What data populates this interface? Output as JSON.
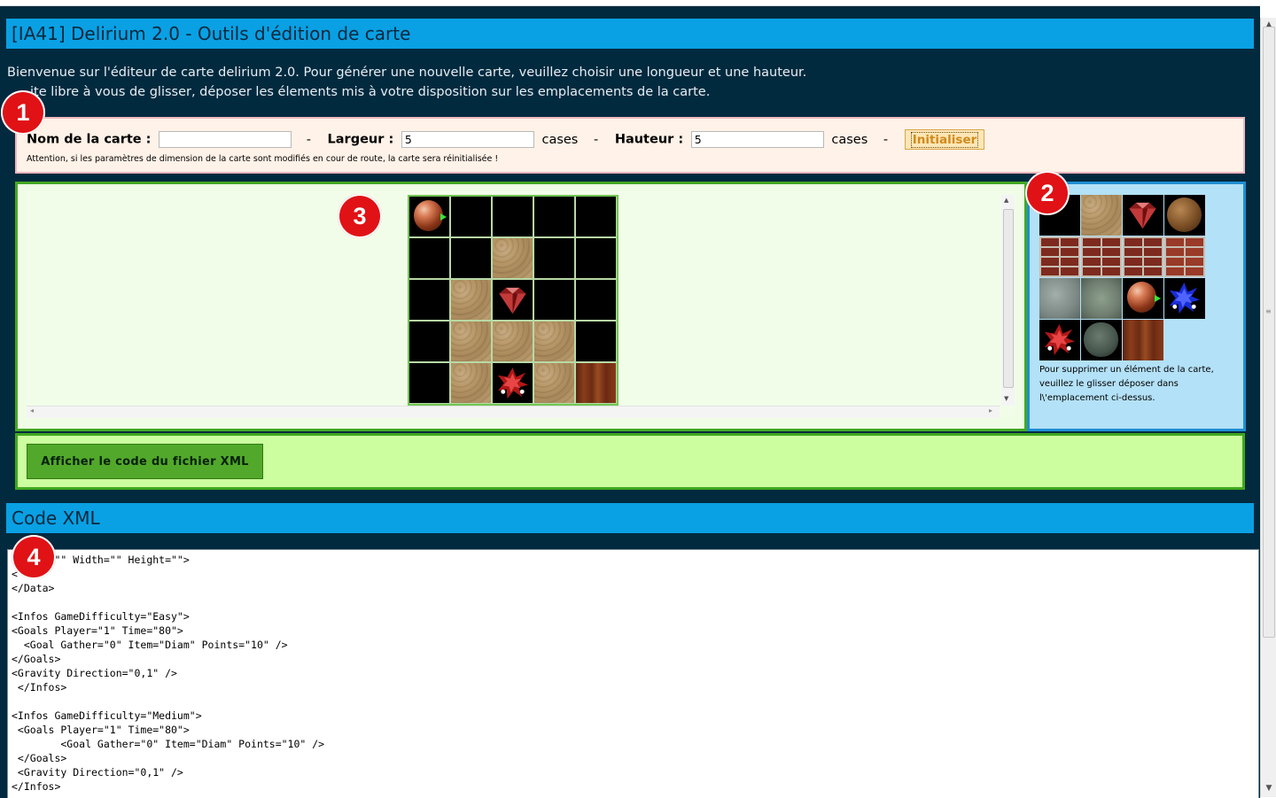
{
  "header": {
    "title": "[IA41] Delirium 2.0 - Outils d'édition de carte"
  },
  "intro": {
    "line1": "Bienvenue sur l'éditeur de carte delirium 2.0. Pour générer une nouvelle carte, veuillez choisir une longueur et une hauteur.",
    "line2": "ite libre à vous de glisser, déposer les élements mis à votre disposition sur les emplacements de la carte."
  },
  "form": {
    "name_label": "Nom de la carte :",
    "name_value": "",
    "sep": "-",
    "width_label": "Largeur :",
    "width_value": "5",
    "width_unit": "cases",
    "height_label": "Hauteur :",
    "height_value": "5",
    "height_unit": "cases",
    "init_button": "Initialiser",
    "warning": "Attention, si les paramètres de dimension de la carte sont modifiés en cour de route, la carte sera réinitialisée !"
  },
  "map": {
    "cols": 5,
    "rows": 5,
    "cells": [
      [
        "player",
        "empty",
        "empty",
        "empty",
        "empty"
      ],
      [
        "empty",
        "empty",
        "dirt",
        "empty",
        "empty"
      ],
      [
        "empty",
        "dirt",
        "diamond",
        "empty",
        "empty"
      ],
      [
        "empty",
        "dirt",
        "dirt",
        "dirt",
        "empty"
      ],
      [
        "empty",
        "dirt",
        "monster-red",
        "dirt",
        "door"
      ]
    ]
  },
  "palette": {
    "items": [
      "empty",
      "dirt",
      "diamond",
      "rock",
      "brick",
      "brick",
      "brick",
      "brick-alt",
      "stone",
      "stone-moss",
      "player",
      "monster-blue",
      "monster-red",
      "boulder-green",
      "door"
    ],
    "note": "Pour supprimer un élément de la carte, veuillez le glisser déposer dans l\\'emplacement ci-dessus."
  },
  "actions": {
    "show_xml": "Afficher le code du fichier XML"
  },
  "code_section": {
    "title": "Code XML",
    "content": "<   me=\"\" Width=\"\" Height=\"\">\n<\n</Data>\n\n<Infos GameDifficulty=\"Easy\">\n<Goals Player=\"1\" Time=\"80\">\n  <Goal Gather=\"0\" Item=\"Diam\" Points=\"10\" />\n</Goals>\n<Gravity Direction=\"0,1\" />\n </Infos>\n\n<Infos GameDifficulty=\"Medium\">\n <Goals Player=\"1\" Time=\"80\">\n        <Goal Gather=\"0\" Item=\"Diam\" Points=\"10\" />\n </Goals>\n <Gravity Direction=\"0,1\" />\n</Infos>"
  },
  "badges": [
    "1",
    "2",
    "3",
    "4"
  ]
}
